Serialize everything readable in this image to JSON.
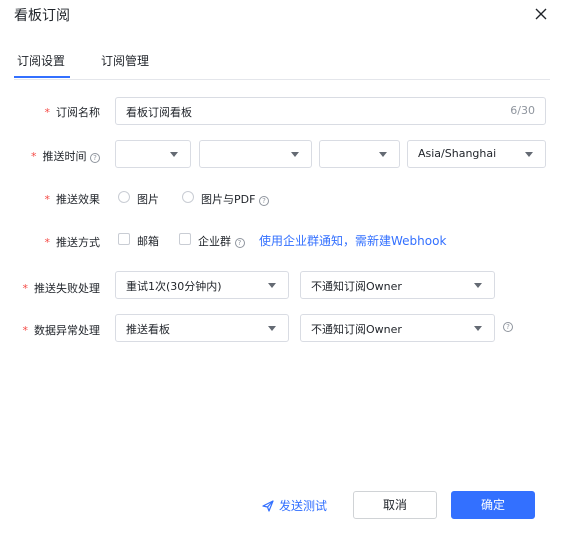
{
  "dialog": {
    "title": "看板订阅"
  },
  "tabs": [
    {
      "label": "订阅设置",
      "active": true
    },
    {
      "label": "订阅管理",
      "active": false
    }
  ],
  "form": {
    "name": {
      "label": "订阅名称",
      "value": "看板订阅看板",
      "count": "6/30"
    },
    "send_time": {
      "label": "推送时间",
      "timezone": "Asia/Shanghai",
      "selects": [
        "",
        "",
        ""
      ]
    },
    "effect": {
      "label": "推送效果",
      "options": [
        {
          "label": "图片",
          "selected": false
        },
        {
          "label": "图片与PDF",
          "selected": false
        }
      ]
    },
    "method": {
      "label": "推送方式",
      "options": [
        {
          "label": "邮箱",
          "checked": false
        },
        {
          "label": "企业群",
          "checked": false
        }
      ],
      "webhook_link": "使用企业群通知，需新建Webhook"
    },
    "failure": {
      "label": "推送失败处理",
      "retry": "重试1次(30分钟内)",
      "notify": "不通知订阅Owner"
    },
    "exception": {
      "label": "数据异常处理",
      "action": "推送看板",
      "notify": "不通知订阅Owner"
    }
  },
  "footer": {
    "send_test": "发送测试",
    "cancel": "取消",
    "confirm": "确定"
  },
  "colors": {
    "accent": "#3370ff",
    "required": "#f54a45",
    "border": "#d9dce3"
  }
}
